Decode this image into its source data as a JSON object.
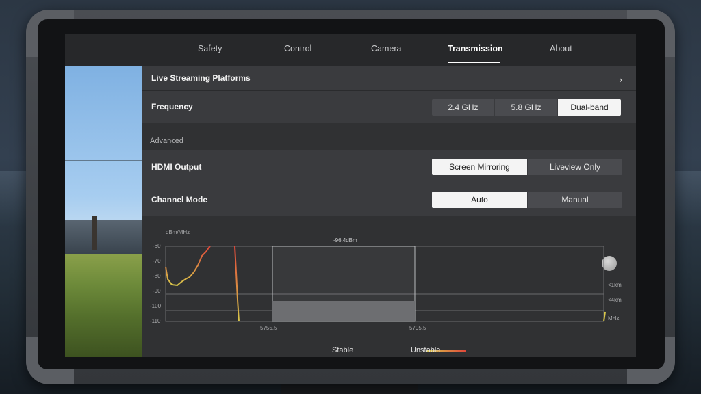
{
  "tabs": [
    "Safety",
    "Control",
    "Camera",
    "Transmission",
    "About"
  ],
  "active_tab": "Transmission",
  "live_streaming": {
    "label": "Live Streaming Platforms"
  },
  "frequency": {
    "label": "Frequency",
    "options": [
      "2.4 GHz",
      "5.8 GHz",
      "Dual-band"
    ],
    "selected": "Dual-band"
  },
  "advanced": {
    "label": "Advanced"
  },
  "hdmi_output": {
    "label": "HDMI Output",
    "options": [
      "Screen Mirroring",
      "Liveview Only"
    ],
    "selected": "Screen Mirroring"
  },
  "channel_mode": {
    "label": "Channel Mode",
    "options": [
      "Auto",
      "Manual"
    ],
    "selected": "Auto"
  },
  "chart_data": {
    "type": "line",
    "ylabel": "dBm/MHz",
    "xlabel": "MHz",
    "y_ticks": [
      "-60",
      "-70",
      "-80",
      "-90",
      "-100",
      "-110"
    ],
    "x_ticks": [
      "5755.5",
      "5795.5"
    ],
    "selected_band_label": "-96.4dBm",
    "distance_labels": [
      "<1km",
      "<4km"
    ],
    "ylim": [
      -110,
      -60
    ]
  },
  "legend": {
    "stable": "Stable",
    "unstable": "Unstable"
  },
  "colors": {
    "stable": "#d7c64a",
    "unstable": "#e0473a",
    "selected": "#f4f4f4"
  }
}
